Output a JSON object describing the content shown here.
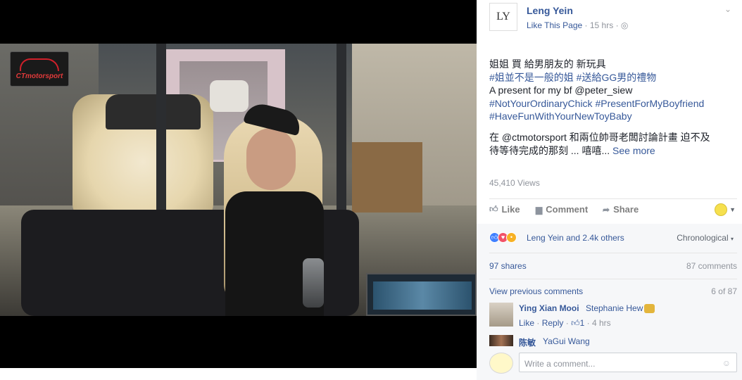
{
  "video": {
    "brand_logo_text": "CTmotorsport"
  },
  "post": {
    "page_name": "Leng Yein",
    "avatar_text": "LY",
    "like_page": "Like This Page",
    "time": "15 hrs",
    "lines": [
      {
        "text": "姐姐 買 給男朋友的 新玩具",
        "type": "text"
      },
      {
        "text": "#姐並不是一般的姐 #送給GG男的禮物",
        "type": "tag"
      },
      {
        "text": "A present for my bf @peter_siew",
        "type": "text"
      },
      {
        "text": "#NotYourOrdinaryChick #PresentForMyBoyfriend",
        "type": "tag"
      },
      {
        "text": "#HaveFunWithYourNewToyBaby",
        "type": "tag"
      }
    ],
    "para2_line1": "在 @ctmotorsport 和兩位帥哥老闆討論計畫 迫不及",
    "para2_line2": "待等待完成的那刻 ... 嘻嘻...",
    "see_more": "See more",
    "views": "45,410 Views"
  },
  "actions": {
    "like": "Like",
    "comment": "Comment",
    "share": "Share"
  },
  "reactions": {
    "summary": "Leng Yein and 2.4k others",
    "order": "Chronological"
  },
  "stats": {
    "shares": "97 shares",
    "comments": "87 comments"
  },
  "comments": {
    "view_previous": "View previous comments",
    "count": "6 of 87",
    "items": [
      {
        "author": "Ying Xian Mooi",
        "text": "Stephanie Hew",
        "like": "Like",
        "reply": "Reply",
        "likes": "1",
        "time": "4 hrs"
      },
      {
        "author": "陈敏",
        "text": "YaGui Wang"
      }
    ],
    "write_placeholder": "Write a comment..."
  },
  "colors": {
    "link": "#365899",
    "meta": "#90949c"
  }
}
